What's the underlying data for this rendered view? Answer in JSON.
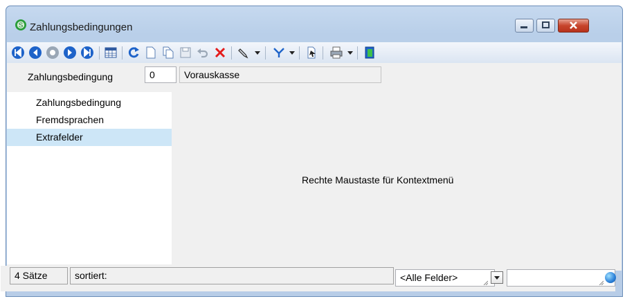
{
  "window": {
    "title": "Zahlungsbedingungen",
    "icons": {
      "app": "sage-s-icon",
      "minimize": "minimize-icon",
      "maximize": "maximize-icon",
      "close": "close-icon"
    }
  },
  "toolbar": {
    "buttons": [
      {
        "name": "first-record-icon"
      },
      {
        "name": "previous-record-icon"
      },
      {
        "name": "search-record-icon"
      },
      {
        "name": "next-record-icon"
      },
      {
        "name": "last-record-icon"
      },
      {
        "name": "table-view-icon"
      },
      {
        "name": "refresh-icon"
      },
      {
        "name": "new-record-icon"
      },
      {
        "name": "copy-record-icon"
      },
      {
        "name": "save-icon"
      },
      {
        "name": "undo-icon"
      },
      {
        "name": "delete-icon"
      },
      {
        "name": "edit-icon"
      },
      {
        "name": "filter-icon"
      },
      {
        "name": "export-icon"
      },
      {
        "name": "print-icon"
      },
      {
        "name": "exit-icon"
      }
    ],
    "colors": {
      "nav_blue": "#1e63c9",
      "delete_red": "#e41b1b"
    }
  },
  "record": {
    "field_label": "Zahlungsbedingung",
    "number": "0",
    "name": "Vorauskasse"
  },
  "nav": {
    "items": [
      {
        "label": "Zahlungsbedingung",
        "selected": false
      },
      {
        "label": "Fremdsprachen",
        "selected": false
      },
      {
        "label": "Extrafelder",
        "selected": true
      }
    ],
    "selected_color": "#cde6f7"
  },
  "main": {
    "hint": "Rechte Maustaste für Kontextmenü"
  },
  "statusbar": {
    "count": "4 Sätze",
    "sort": "sortiert:",
    "field_filter": "<Alle Felder>",
    "search_value": ""
  }
}
